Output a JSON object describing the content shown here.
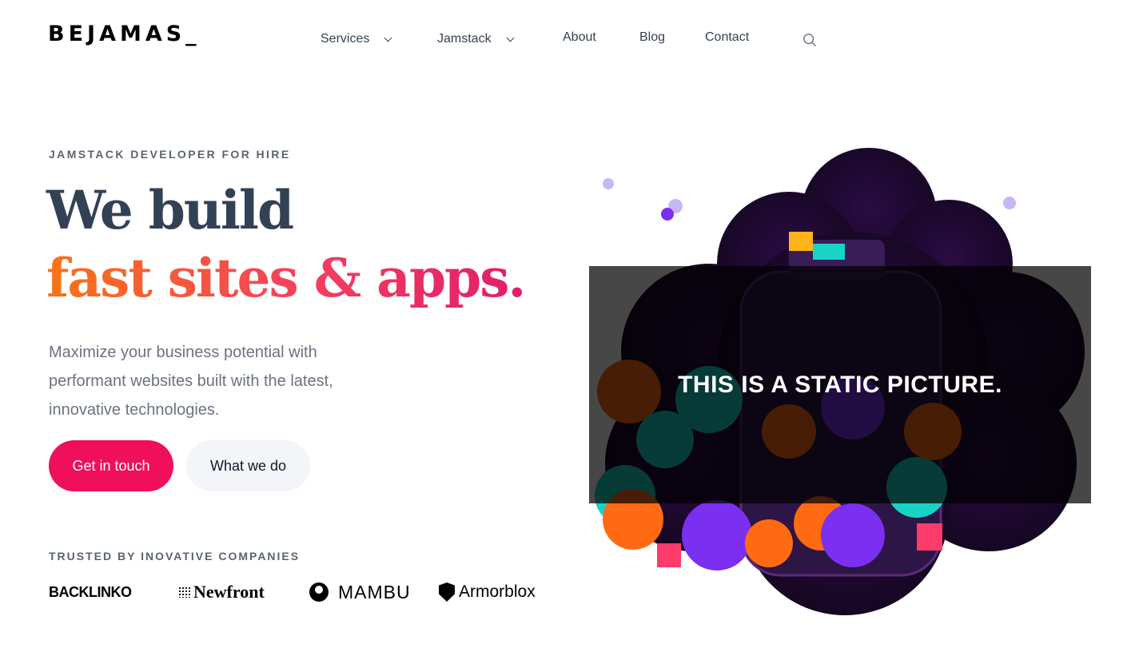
{
  "brand": {
    "logo": "BEJAMAS_"
  },
  "nav": {
    "items": [
      {
        "label": "Services",
        "has_dropdown": true
      },
      {
        "label": "Jamstack",
        "has_dropdown": true
      },
      {
        "label": "About",
        "has_dropdown": false
      },
      {
        "label": "Blog",
        "has_dropdown": false
      },
      {
        "label": "Contact",
        "has_dropdown": false
      }
    ],
    "search_icon": "search-icon"
  },
  "hero": {
    "eyebrow": "JAMSTACK DEVELOPER FOR HIRE",
    "headline_1": "We build",
    "headline_2": "fast sites & apps.",
    "lead": "Maximize your business potential with performant websites built with the latest, innovative technologies.",
    "primary_button": "Get in touch",
    "secondary_button": "What we do",
    "image_caption": "THIS IS A STATIC PICTURE."
  },
  "trusted": {
    "label": "TRUSTED BY INOVATIVE COMPANIES",
    "logos": [
      "BACKLINKO",
      "Newfront",
      "MAMBU",
      "Armorblox"
    ]
  },
  "colors": {
    "accent": "#ef0f5a",
    "headline_dark": "#334155",
    "gradient_start": "#f97316",
    "gradient_end": "#e11d6a"
  }
}
